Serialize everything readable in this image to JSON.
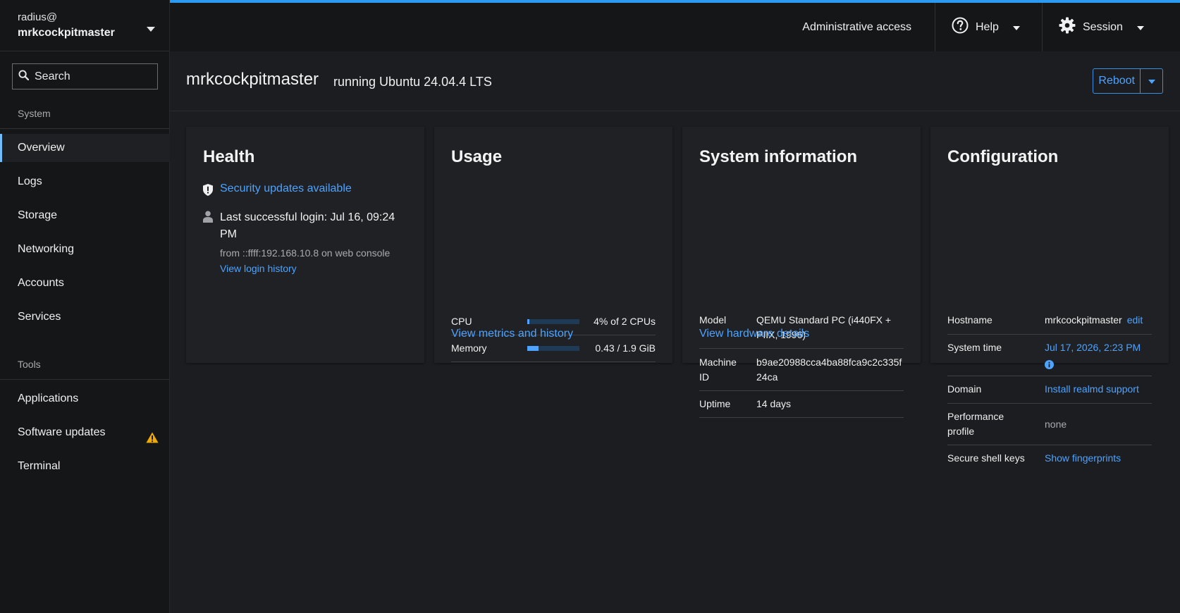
{
  "sidebar": {
    "user": "radius@",
    "host": "mrkcockpitmaster",
    "search_placeholder": "Search",
    "system_heading": "System",
    "system_items": [
      {
        "label": "Overview",
        "active": true
      },
      {
        "label": "Logs"
      },
      {
        "label": "Storage"
      },
      {
        "label": "Networking"
      },
      {
        "label": "Accounts"
      },
      {
        "label": "Services"
      }
    ],
    "tools_heading": "Tools",
    "tools_items": [
      {
        "label": "Applications"
      },
      {
        "label": "Software updates",
        "icon": "warning-icon"
      },
      {
        "label": "Terminal"
      }
    ]
  },
  "topbar": {
    "admin_access": "Administrative access",
    "help": "Help",
    "session": "Session"
  },
  "header": {
    "title": "mrkcockpitmaster",
    "subtitle": "running Ubuntu 24.04.4 LTS",
    "reboot": "Reboot"
  },
  "health": {
    "title": "Health",
    "security_updates": "Security updates available",
    "last_login": "Last successful login: Jul 16, 09:24 PM",
    "login_from": "from ::ffff:192.168.10.8 on web console",
    "view_history": "View login history"
  },
  "usage": {
    "title": "Usage",
    "cpu_label": "CPU",
    "cpu_value": "4% of 2 CPUs",
    "cpu_fraction": 0.04,
    "memory_label": "Memory",
    "memory_value": "0.43 / 1.9 GiB",
    "memory_fraction": 0.22,
    "link": "View metrics and history"
  },
  "sysinfo": {
    "title": "System information",
    "model_label": "Model",
    "model_value": "QEMU Standard PC (i440FX + PIIX, 1996)",
    "machine_id_label": "Machine ID",
    "machine_id_value": "b9ae20988cca4ba88fca9c2c335f24ca",
    "uptime_label": "Uptime",
    "uptime_value": "14 days",
    "link": "View hardware details"
  },
  "config": {
    "title": "Configuration",
    "hostname_label": "Hostname",
    "hostname_value": "mrkcockpitmaster",
    "hostname_edit": "edit",
    "time_label": "System time",
    "time_value": "Jul 17, 2026, 2:23 PM",
    "domain_label": "Domain",
    "domain_value": "Install realmd support",
    "perf_label": "Performance profile",
    "perf_value": "none",
    "ssh_label": "Secure shell keys",
    "ssh_value": "Show fingerprints"
  },
  "colors": {
    "accent": "#4da3ff",
    "topbar_accent": "#2b9af3",
    "warning": "#f0ab00"
  }
}
